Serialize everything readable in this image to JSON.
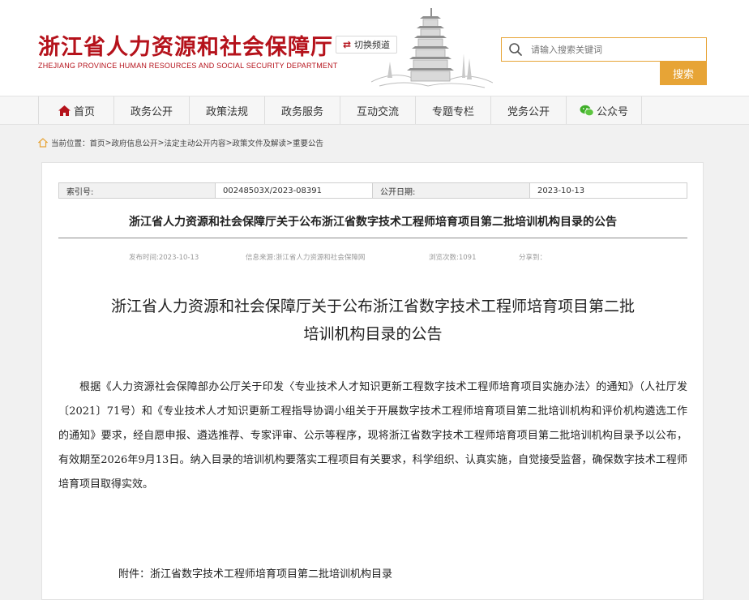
{
  "header": {
    "logo_cn": "浙江省人力资源和社会保障厅",
    "logo_en": "ZHEJIANG PROVINCE HUMAN RESOURCES AND SOCIAL SECURITY DEPARTMENT",
    "switch_label": "切换频道",
    "search_placeholder": "请输入搜索关键词",
    "search_button": "搜索"
  },
  "nav": {
    "items": [
      {
        "label": "首页",
        "icon": "home-icon"
      },
      {
        "label": "政务公开"
      },
      {
        "label": "政策法规"
      },
      {
        "label": "政务服务"
      },
      {
        "label": "互动交流"
      },
      {
        "label": "专题专栏"
      },
      {
        "label": "党务公开"
      },
      {
        "label": "公众号",
        "icon": "wechat-icon"
      }
    ]
  },
  "breadcrumb": {
    "prefix": "当前位置：",
    "items": [
      "首页",
      "政府信息公开",
      "法定主动公开内容",
      "政策文件及解读",
      "重要公告"
    ],
    "separator": ">"
  },
  "meta": {
    "index_label": "索引号:",
    "index_value": "00248503X/2023-08391",
    "date_label": "公开日期:",
    "date_value": "2023-10-13"
  },
  "article": {
    "short_title": "浙江省人力资源和社会保障厅关于公布浙江省数字技术工程师培育项目第二批培训机构目录的公告",
    "publish_time": "发布时间:2023-10-13",
    "source": "信息来源:浙江省人力资源和社会保障网",
    "views": "浏览次数:1091",
    "share": "分享到：",
    "title_line1": "浙江省人力资源和社会保障厅关于公布浙江省数字技术工程师培育项目第二批",
    "title_line2": "培训机构目录的公告",
    "body": "根据《人力资源社会保障部办公厅关于印发〈专业技术人才知识更新工程数字技术工程师培育项目实施办法〉的通知》（人社厅发〔2021〕71号）和《专业技术人才知识更新工程指导协调小组关于开展数字技术工程师培育项目第二批培训机构和评价机构遴选工作的通知》要求，经自愿申报、遴选推荐、专家评审、公示等程序，现将浙江省数字技术工程师培育项目第二批培训机构目录予以公布，有效期至2026年9月13日。纳入目录的培训机构要落实工程项目有关要求，科学组织、认真实施，自觉接受监督，确保数字技术工程师培育项目取得实效。",
    "attachment": "附件：浙江省数字技术工程师培育项目第二批培训机构目录"
  },
  "colors": {
    "brand_red": "#b5121b",
    "accent_orange": "#e7a436"
  }
}
